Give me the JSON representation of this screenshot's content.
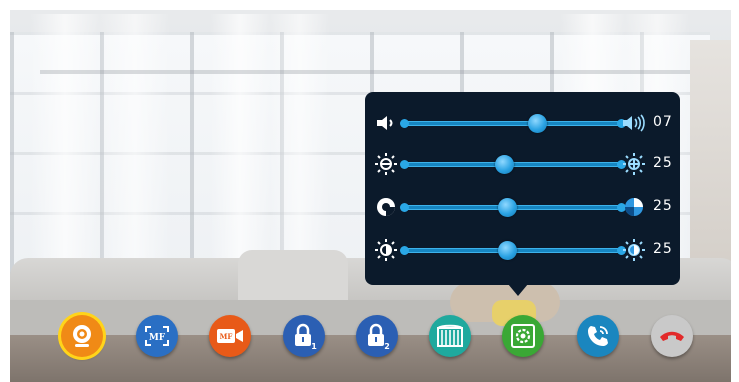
{
  "panel": {
    "rows": [
      {
        "id": "volume",
        "left_icon": "speaker-icon",
        "right_icon": "speaker-loud-icon",
        "level": 0.61,
        "value": "07"
      },
      {
        "id": "brightness",
        "left_icon": "brightness-low-icon",
        "right_icon": "brightness-high-icon",
        "level": 0.46,
        "value": "25"
      },
      {
        "id": "color",
        "left_icon": "color-saturation-low-icon",
        "right_icon": "color-saturation-high-icon",
        "level": 0.47,
        "value": "25"
      },
      {
        "id": "contrast",
        "left_icon": "contrast-low-icon",
        "right_icon": "contrast-high-icon",
        "level": 0.47,
        "value": "25"
      }
    ]
  },
  "toolbar": {
    "buttons": [
      {
        "id": "monitor",
        "icon": "camera-icon",
        "color": "#f08a16",
        "selected": true
      },
      {
        "id": "snapshot",
        "icon": "snapshot-mf-icon",
        "color": "#2a6fc4",
        "label": "MF"
      },
      {
        "id": "record",
        "icon": "record-mf-icon",
        "color": "#e85a18",
        "label": "MF"
      },
      {
        "id": "unlock1",
        "icon": "lock-1-icon",
        "color": "#2b5fb3",
        "label": "1"
      },
      {
        "id": "unlock2",
        "icon": "lock-2-icon",
        "color": "#2b5fb3",
        "label": "2"
      },
      {
        "id": "gate",
        "icon": "gate-icon",
        "color": "#1fa99e"
      },
      {
        "id": "settings",
        "icon": "settings-icon",
        "color": "#3aa835"
      },
      {
        "id": "answer",
        "icon": "call-answer-icon",
        "color": "#1a86bf"
      },
      {
        "id": "hangup",
        "icon": "call-hangup-icon",
        "color": "#c9c9c9"
      }
    ]
  }
}
